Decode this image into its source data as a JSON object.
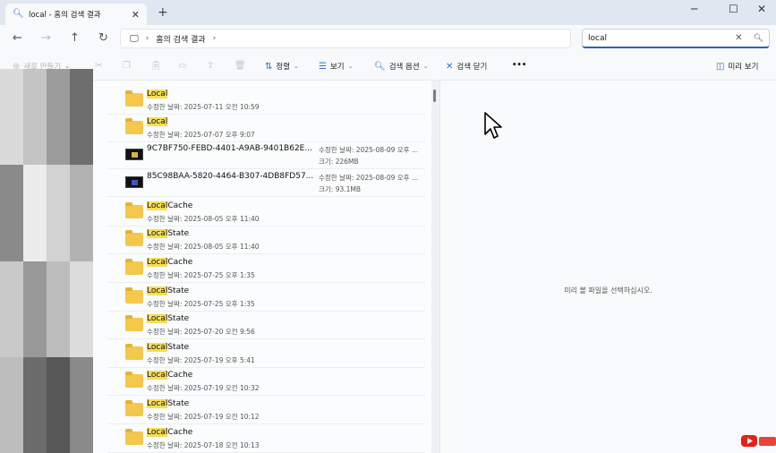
{
  "window": {
    "tab_title": "local - 홈의 검색 결과",
    "close_tab": "✕",
    "new_tab": "+",
    "minimize": "─",
    "maximize": "☐",
    "close": "✕"
  },
  "nav": {
    "back": "←",
    "forward": "→",
    "up": "↑",
    "refresh": "↻",
    "breadcrumb": [
      "홈의 검색 결과"
    ],
    "search_value": "local"
  },
  "commands": {
    "new": "새로 만들기",
    "sort": "정렬",
    "view": "보기",
    "search_options": "검색 옵션",
    "close_search": "검색 닫기",
    "more": "•••",
    "preview": "미리 보기"
  },
  "files": [
    {
      "type": "folder",
      "highlight": "Local",
      "rest": "",
      "meta": "수정한 날짜: 2025-07-11 오전 10:59"
    },
    {
      "type": "folder",
      "highlight": "Local",
      "rest": "",
      "meta": "수정한 날짜: 2025-07-07 오후 9:07"
    },
    {
      "type": "video",
      "name": "9C7BF750-FEBD-4401-A9AB-9401B62E...",
      "modified": "수정한 날짜: 2025-08-09 오후 ...",
      "size": "크기: 226MB"
    },
    {
      "type": "video",
      "name": "85C98BAA-5820-4464-B307-4DB8FD57...",
      "modified": "수정한 날짜: 2025-08-09 오후 ...",
      "size": "크기: 93.1MB"
    },
    {
      "type": "folder",
      "highlight": "Local",
      "rest": "Cache",
      "meta": "수정한 날짜: 2025-08-05 오후 11:40"
    },
    {
      "type": "folder",
      "highlight": "Local",
      "rest": "State",
      "meta": "수정한 날짜: 2025-08-05 오후 11:40"
    },
    {
      "type": "folder",
      "highlight": "Local",
      "rest": "Cache",
      "meta": "수정한 날짜: 2025-07-25 오후 1:35"
    },
    {
      "type": "folder",
      "highlight": "Local",
      "rest": "State",
      "meta": "수정한 날짜: 2025-07-25 오후 1:35"
    },
    {
      "type": "folder",
      "highlight": "Local",
      "rest": "State",
      "meta": "수정한 날짜: 2025-07-20 오전 9:56"
    },
    {
      "type": "folder",
      "highlight": "Local",
      "rest": "State",
      "meta": "수정한 날짜: 2025-07-19 오후 5:41"
    },
    {
      "type": "folder",
      "highlight": "Local",
      "rest": "Cache",
      "meta": "수정한 날짜: 2025-07-19 오전 10:32"
    },
    {
      "type": "folder",
      "highlight": "Local",
      "rest": "State",
      "meta": "수정한 날짜: 2025-07-19 오전 10:12"
    },
    {
      "type": "folder",
      "highlight": "Local",
      "rest": "Cache",
      "meta": "수정한 날짜: 2025-07-18 오전 10:13"
    }
  ],
  "preview_message": "미리 볼 파일을 선택하십시오.",
  "colors": {
    "accent": "#2a63b8",
    "highlight": "#f6dd55",
    "folder": "#f3c84c"
  }
}
